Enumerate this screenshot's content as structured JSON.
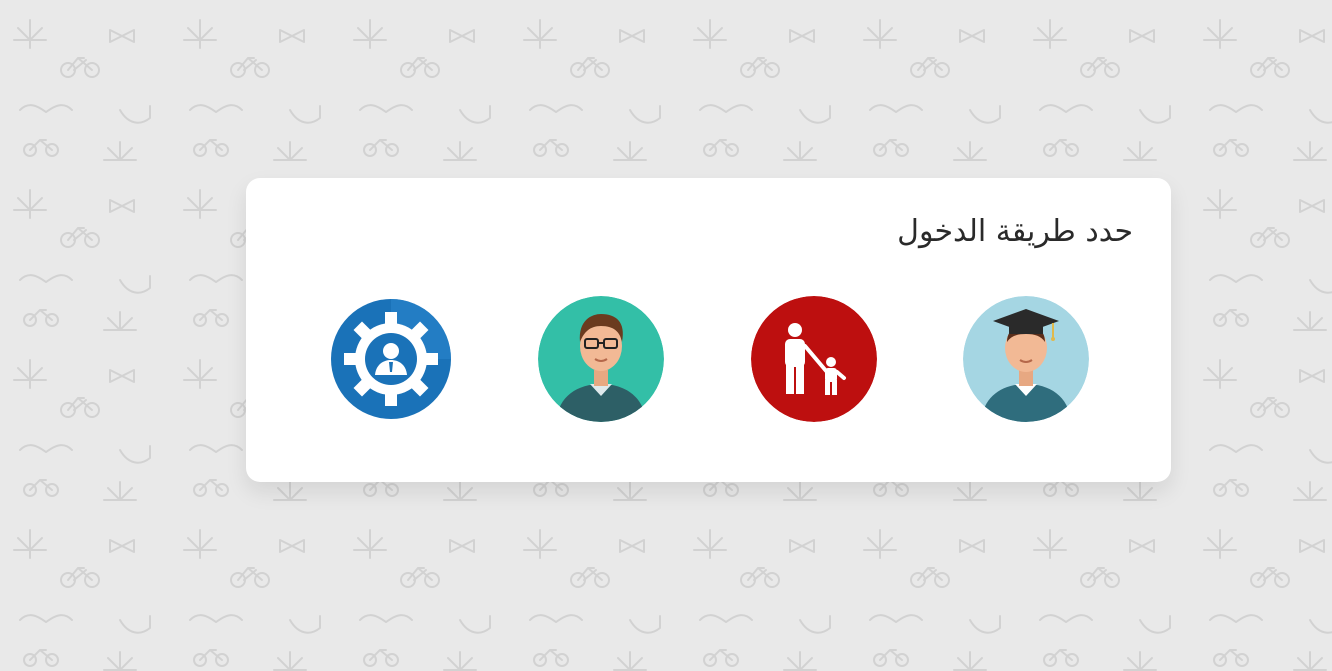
{
  "login_panel": {
    "title": "حدد طريقة الدخول",
    "options": [
      {
        "role": "student",
        "icon": "student-graduate-icon",
        "color": "#a5d6e3"
      },
      {
        "role": "parent",
        "icon": "parent-child-icon",
        "color": "#bd0f0f"
      },
      {
        "role": "teacher",
        "icon": "teacher-avatar-icon",
        "color": "#33bfa7"
      },
      {
        "role": "admin",
        "icon": "admin-gear-icon",
        "color": "#1a72b8"
      }
    ]
  }
}
